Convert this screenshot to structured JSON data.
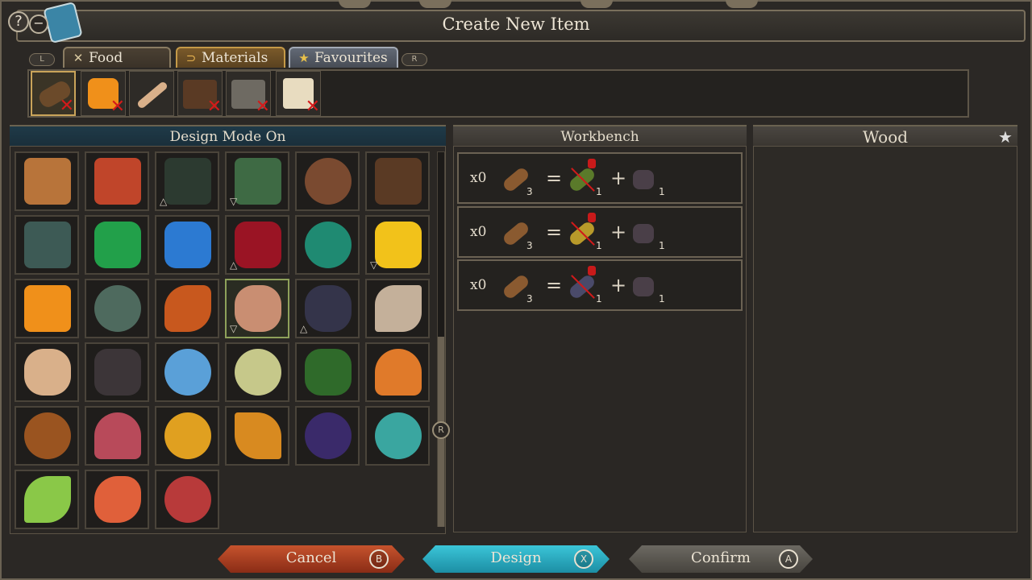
{
  "header": {
    "title": "Create New Item",
    "help_label": "?",
    "minus_label": "−"
  },
  "tabs": {
    "left_key": "L",
    "right_key": "R",
    "items": [
      {
        "label": "Food",
        "icon": "fork-knife-icon"
      },
      {
        "label": "Materials",
        "icon": "materials-icon"
      },
      {
        "label": "Favourites",
        "icon": "star-icon"
      }
    ]
  },
  "favourites": [
    {
      "name": "wood-log",
      "removable": true,
      "selected": true
    },
    {
      "name": "amber",
      "removable": true
    },
    {
      "name": "bone",
      "removable": false
    },
    {
      "name": "leather",
      "removable": true
    },
    {
      "name": "stone-slab",
      "removable": true
    },
    {
      "name": "cloth-block",
      "removable": true
    }
  ],
  "design_panel": {
    "heading": "Design Mode On",
    "scroll_key": "R"
  },
  "workbench": {
    "heading": "Workbench",
    "recipes": [
      {
        "qty": "x0",
        "input_count": "3",
        "output1_count": "1",
        "output2_count": "1",
        "equals": "=",
        "plus": "+"
      },
      {
        "qty": "x0",
        "input_count": "3",
        "output1_count": "1",
        "output2_count": "1",
        "equals": "=",
        "plus": "+"
      },
      {
        "qty": "x0",
        "input_count": "3",
        "output1_count": "1",
        "output2_count": "1",
        "equals": "=",
        "plus": "+"
      }
    ]
  },
  "detail": {
    "heading": "Wood"
  },
  "buttons": {
    "cancel": {
      "label": "Cancel",
      "key": "B"
    },
    "design": {
      "label": "Design",
      "key": "X"
    },
    "confirm": {
      "label": "Confirm",
      "key": "A"
    }
  },
  "colors": {
    "cancel": "#c6532d",
    "design": "#3bc5d8",
    "confirm": "#6c6962",
    "selected_border": "#8ea15a"
  }
}
